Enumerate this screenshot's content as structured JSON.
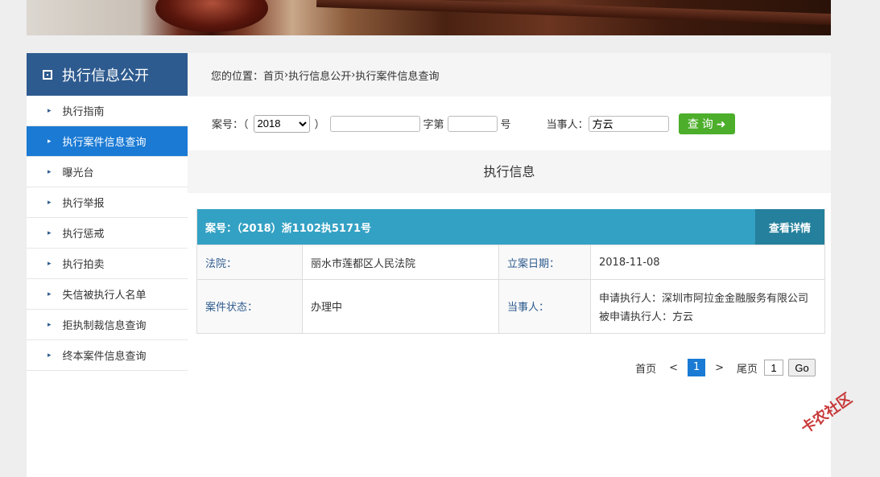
{
  "sidebar": {
    "title": "执行信息公开",
    "items": [
      {
        "label": "执行指南"
      },
      {
        "label": "执行案件信息查询",
        "active": true
      },
      {
        "label": "曝光台"
      },
      {
        "label": "执行举报"
      },
      {
        "label": "执行惩戒"
      },
      {
        "label": "执行拍卖"
      },
      {
        "label": "失信被执行人名单"
      },
      {
        "label": "拒执制裁信息查询"
      },
      {
        "label": "终本案件信息查询"
      }
    ]
  },
  "breadcrumb": {
    "prefix": "您的位置：",
    "home": "首页",
    "sep": " › ",
    "level1": "执行信息公开",
    "level2": "执行案件信息查询"
  },
  "search": {
    "case_label": "案号：（",
    "year": "2018",
    "close_paren": "）",
    "zi_label": "字第",
    "hao_label": "号",
    "party_label": "当事人：",
    "party_value": "方云",
    "submit_label": "查 询 ➜"
  },
  "section": {
    "title": "执行信息"
  },
  "case": {
    "number": "案号：（2018）浙1102执5171号",
    "detail_label": "查看详情",
    "court_label": "法院：",
    "court_value": "丽水市莲都区人民法院",
    "date_label": "立案日期：",
    "date_value": "2018-11-08",
    "status_label": "案件状态：",
    "status_value": "办理中",
    "party_label": "当事人：",
    "applicant": "申请执行人：深圳市阿拉金金融服务有限公司",
    "respondent": "被申请执行人：方云"
  },
  "pager": {
    "first": "首页",
    "prev": "<",
    "current": "1",
    "next": ">",
    "last": "尾页",
    "goto_value": "1",
    "go": "Go"
  },
  "watermark": "卡农社区"
}
